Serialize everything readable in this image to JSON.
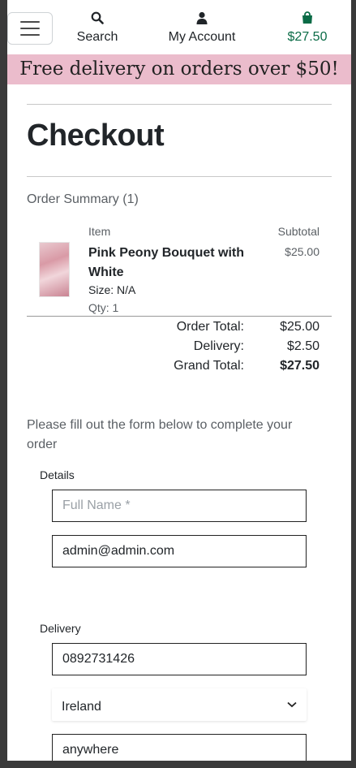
{
  "nav": {
    "search_label": "Search",
    "account_label": "My Account",
    "bag_total": "$27.50"
  },
  "banner": {
    "text": "Free delivery on orders over $50!"
  },
  "page_title": "Checkout",
  "order_summary": {
    "label": "Order Summary (1)",
    "col_item": "Item",
    "col_subtotal": "Subtotal",
    "items": [
      {
        "name": "Pink Peony Bouquet with White",
        "size": "Size: N/A",
        "qty": "Qty: 1",
        "subtotal": "$25.00"
      }
    ],
    "order_total_label": "Order Total:",
    "order_total": "$25.00",
    "delivery_label": "Delivery:",
    "delivery": "$2.50",
    "grand_total_label": "Grand Total:",
    "grand_total": "$27.50"
  },
  "form": {
    "instructions": "Please fill out the form below to complete your order",
    "details_legend": "Details",
    "full_name_placeholder": "Full Name *",
    "full_name_value": "",
    "email_value": "admin@admin.com",
    "delivery_legend": "Delivery",
    "phone_value": "0892731426",
    "country_selected": "Ireland",
    "address_value": "anywhere"
  },
  "colors": {
    "banner_bg": "#ebbccc",
    "bag_green": "#0a6b46"
  }
}
